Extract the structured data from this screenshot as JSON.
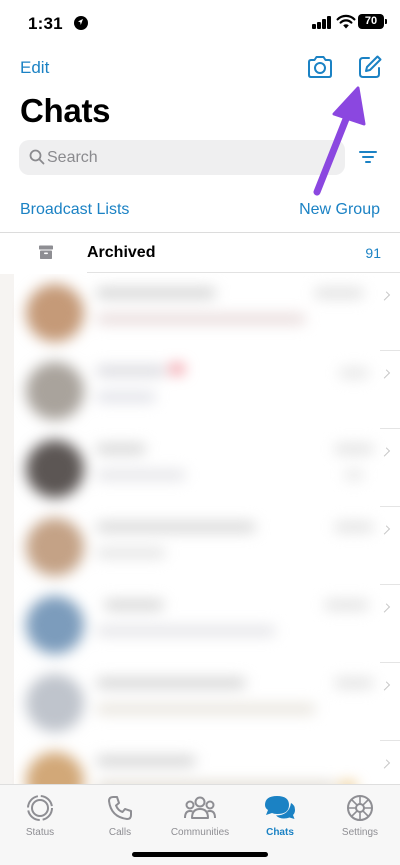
{
  "status_bar": {
    "time": "1:31",
    "battery": "70"
  },
  "nav": {
    "edit_label": "Edit"
  },
  "title": "Chats",
  "search": {
    "placeholder": "Search"
  },
  "links": {
    "broadcast": "Broadcast Lists",
    "new_group": "New Group"
  },
  "archived": {
    "label": "Archived",
    "count": "91"
  },
  "tabs": [
    {
      "label": "Status",
      "icon": "status-icon",
      "active": false
    },
    {
      "label": "Calls",
      "icon": "calls-icon",
      "active": false
    },
    {
      "label": "Communities",
      "icon": "communities-icon",
      "active": false
    },
    {
      "label": "Chats",
      "icon": "chats-icon",
      "active": true
    },
    {
      "label": "Settings",
      "icon": "settings-icon",
      "active": false
    }
  ],
  "colors": {
    "accent": "#1b82c4",
    "annotation_arrow": "#8b47e0"
  }
}
